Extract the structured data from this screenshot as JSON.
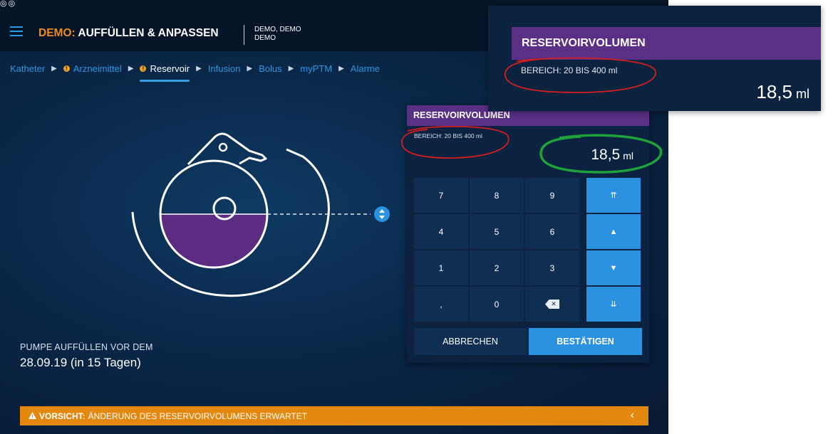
{
  "status_icons": "◎◎",
  "header": {
    "title_prefix": "DEMO:",
    "title_main": " AUFFÜLLEN & ANPASSEN",
    "patient_line1": "DEMO, DEMO",
    "patient_line2": "DEMO"
  },
  "breadcrumbs": [
    {
      "label": "Katheter",
      "warning": false
    },
    {
      "label": "Arzneimittel",
      "warning": true
    },
    {
      "label": "Reservoir",
      "warning": true,
      "active": true
    },
    {
      "label": "Infusion",
      "warning": false
    },
    {
      "label": "Bolus",
      "warning": false
    },
    {
      "label": "myPTM",
      "warning": false
    },
    {
      "label": "Alarme",
      "warning": false
    }
  ],
  "breadcrumb_warning_glyph": "!",
  "pump": {
    "fill_level": 0.5,
    "fill_color": "#5b2c82",
    "adjust_icon": "up-down-arrow-icon"
  },
  "refill": {
    "label": "PUMPE AUFFÜLLEN VOR DEM",
    "date": "28.09.19 (in 15 Tagen)"
  },
  "panel": {
    "title": "RESERVOIRVOLUMEN",
    "range": "BEREICH: 20 BIS 400 ml",
    "value": "18,5",
    "unit": "ml",
    "keys": [
      [
        "7",
        "8",
        "9"
      ],
      [
        "4",
        "5",
        "6"
      ],
      [
        "1",
        "2",
        "3"
      ],
      [
        ",",
        "0",
        "⌫"
      ]
    ],
    "step_keys": [
      "⇈",
      "▲",
      "▼",
      "⇊"
    ],
    "cancel_label": "ABBRECHEN",
    "confirm_label": "BESTÄTIGEN"
  },
  "zoom": {
    "title": "RESERVOIRVOLUMEN",
    "range": "BEREICH: 20 BIS 400 ml",
    "value": "18,5",
    "unit": "ml"
  },
  "warning": {
    "icon": "warning-triangle-icon",
    "label": "VORSICHT:",
    "message": "ÄNDERUNG DES RESERVOIRVOLUMENS ERWARTET",
    "chevron": "‹"
  },
  "colors": {
    "accent_blue": "#2a92e0",
    "purple": "#5a2f86",
    "orange": "#e3870f",
    "annotation_red": "#d21e1e",
    "annotation_green": "#1fa23a"
  }
}
